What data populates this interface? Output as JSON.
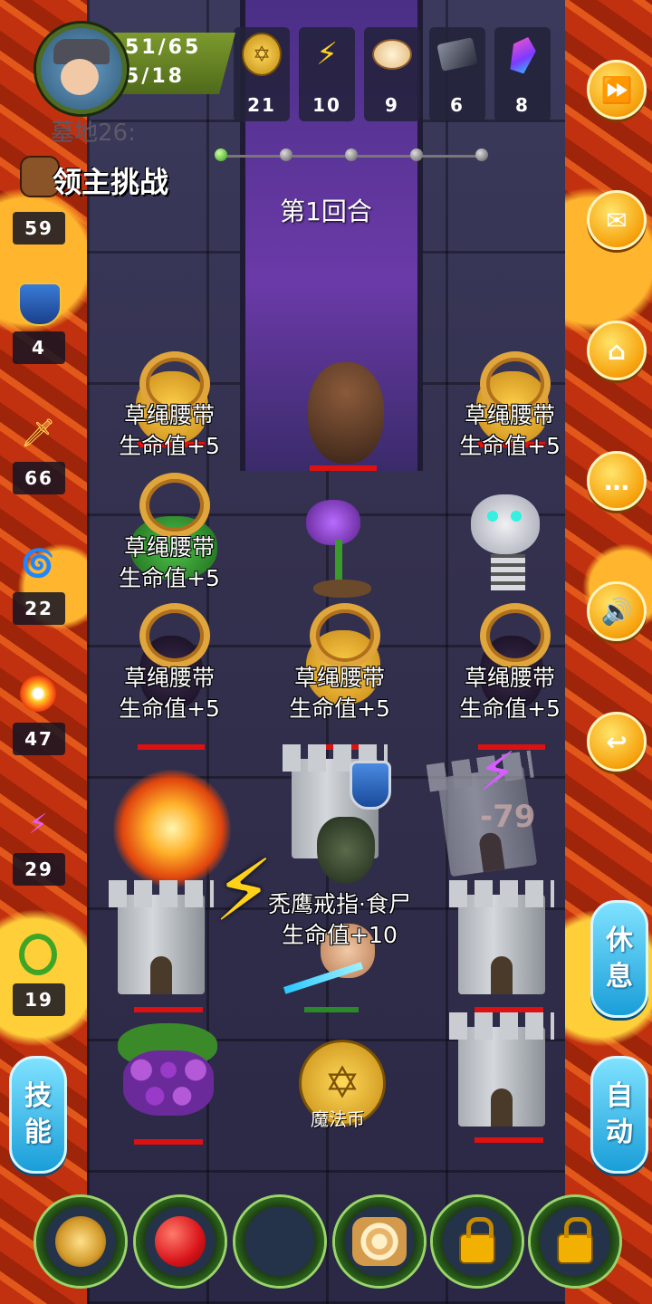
{
  "hud": {
    "hp": "51/65",
    "exp": "5/18",
    "resources": [
      {
        "icon": "gold-coin-icon",
        "value": "21"
      },
      {
        "icon": "lightning-icon",
        "value": "10"
      },
      {
        "icon": "dumpling-icon",
        "value": "9"
      },
      {
        "icon": "ore-icon",
        "value": "6"
      },
      {
        "icon": "crystal-icon",
        "value": "8"
      }
    ]
  },
  "floor_label": "墓地26:",
  "boss_challenge": "领主挑战",
  "round_label": "第1回合",
  "left_stats": [
    {
      "icon": "attack-fist-icon",
      "value": "59"
    },
    {
      "icon": "shield-icon",
      "value": "4"
    },
    {
      "icon": "flame-sword-icon",
      "value": "66"
    },
    {
      "icon": "water-swirl-icon",
      "value": "22"
    },
    {
      "icon": "fire-burst-icon",
      "value": "47"
    },
    {
      "icon": "lightning-purple-icon",
      "value": "29"
    },
    {
      "icon": "green-ring-icon",
      "value": "19"
    }
  ],
  "side_buttons": {
    "skill": "技能",
    "rest": "休息",
    "auto": "自动"
  },
  "board": {
    "belt_name": "草绳腰带",
    "belt_bonus": "生命值+5",
    "ring_name": "秃鹰戒指·食尸",
    "ring_bonus": "生命值+10",
    "coin_label": "魔法币",
    "damage_text": "-79"
  },
  "colors": {
    "button_orange": "#f6a10c",
    "pill_blue": "#1a9ed8",
    "hp_red": "#dd1111",
    "stats_green": "#7d9a2e"
  }
}
